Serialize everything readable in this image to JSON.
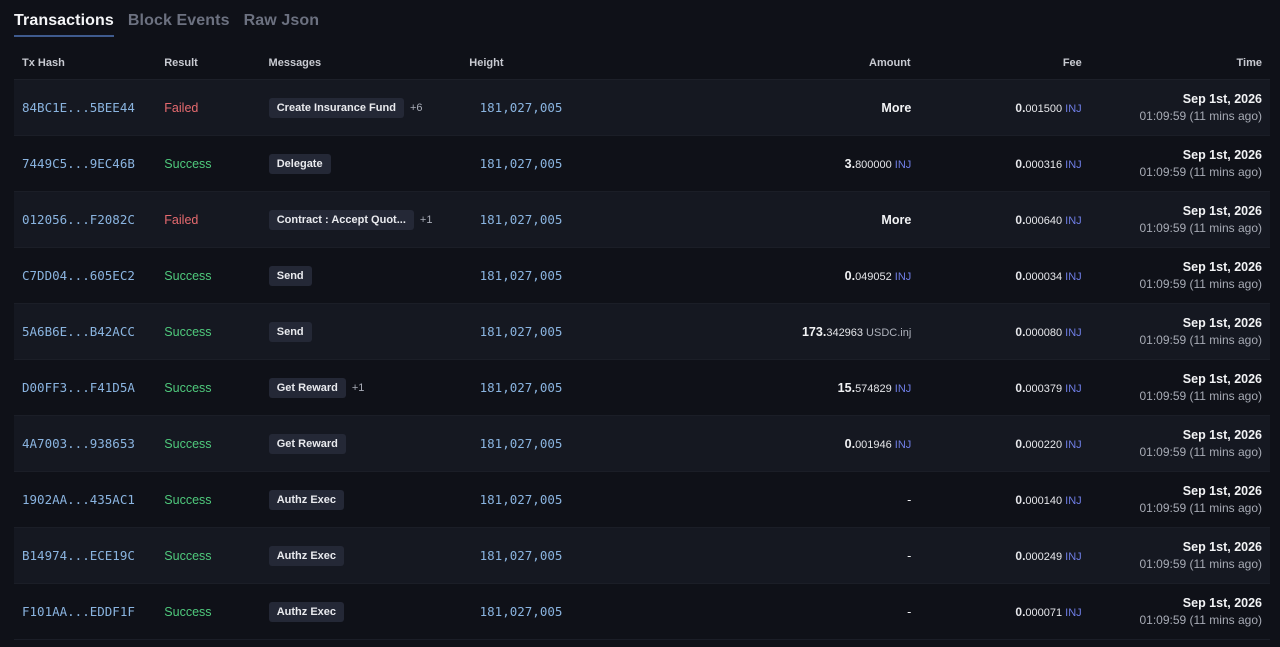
{
  "tabs": [
    {
      "label": "Transactions",
      "active": true
    },
    {
      "label": "Block Events",
      "active": false
    },
    {
      "label": "Raw Json",
      "active": false
    }
  ],
  "columns": {
    "hash": "Tx Hash",
    "result": "Result",
    "messages": "Messages",
    "height": "Height",
    "amount": "Amount",
    "fee": "Fee",
    "time": "Time"
  },
  "rows": [
    {
      "hash": "84BC1E...5BEE44",
      "result": "Failed",
      "status": "failed",
      "message": "Create Insurance Fund",
      "extra": "+6",
      "height": "181,027,005",
      "amount": {
        "int": "More",
        "frac": "",
        "unit": "",
        "type": "text"
      },
      "fee": {
        "int": "0.",
        "frac": "001500",
        "unit": "INJ"
      },
      "date": "Sep 1st, 2026",
      "time": "01:09:59 (11 mins ago)"
    },
    {
      "hash": "7449C5...9EC46B",
      "result": "Success",
      "status": "success",
      "message": "Delegate",
      "extra": "",
      "height": "181,027,005",
      "amount": {
        "int": "3.",
        "frac": "800000",
        "unit": "INJ",
        "type": "num"
      },
      "fee": {
        "int": "0.",
        "frac": "000316",
        "unit": "INJ"
      },
      "date": "Sep 1st, 2026",
      "time": "01:09:59 (11 mins ago)"
    },
    {
      "hash": "012056...F2082C",
      "result": "Failed",
      "status": "failed",
      "message": "Contract : Accept Quot...",
      "extra": "+1",
      "height": "181,027,005",
      "amount": {
        "int": "More",
        "frac": "",
        "unit": "",
        "type": "text"
      },
      "fee": {
        "int": "0.",
        "frac": "000640",
        "unit": "INJ"
      },
      "date": "Sep 1st, 2026",
      "time": "01:09:59 (11 mins ago)"
    },
    {
      "hash": "C7DD04...605EC2",
      "result": "Success",
      "status": "success",
      "message": "Send",
      "extra": "",
      "height": "181,027,005",
      "amount": {
        "int": "0.",
        "frac": "049052",
        "unit": "INJ",
        "type": "num"
      },
      "fee": {
        "int": "0.",
        "frac": "000034",
        "unit": "INJ"
      },
      "date": "Sep 1st, 2026",
      "time": "01:09:59 (11 mins ago)"
    },
    {
      "hash": "5A6B6E...B42ACC",
      "result": "Success",
      "status": "success",
      "message": "Send",
      "extra": "",
      "height": "181,027,005",
      "amount": {
        "int": "173.",
        "frac": "342963",
        "unit": "USDC.inj",
        "type": "num-grey"
      },
      "fee": {
        "int": "0.",
        "frac": "000080",
        "unit": "INJ"
      },
      "date": "Sep 1st, 2026",
      "time": "01:09:59 (11 mins ago)"
    },
    {
      "hash": "D00FF3...F41D5A",
      "result": "Success",
      "status": "success",
      "message": "Get Reward",
      "extra": "+1",
      "height": "181,027,005",
      "amount": {
        "int": "15.",
        "frac": "574829",
        "unit": "INJ",
        "type": "num"
      },
      "fee": {
        "int": "0.",
        "frac": "000379",
        "unit": "INJ"
      },
      "date": "Sep 1st, 2026",
      "time": "01:09:59 (11 mins ago)"
    },
    {
      "hash": "4A7003...938653",
      "result": "Success",
      "status": "success",
      "message": "Get Reward",
      "extra": "",
      "height": "181,027,005",
      "amount": {
        "int": "0.",
        "frac": "001946",
        "unit": "INJ",
        "type": "num"
      },
      "fee": {
        "int": "0.",
        "frac": "000220",
        "unit": "INJ"
      },
      "date": "Sep 1st, 2026",
      "time": "01:09:59 (11 mins ago)"
    },
    {
      "hash": "1902AA...435AC1",
      "result": "Success",
      "status": "success",
      "message": "Authz Exec",
      "extra": "",
      "height": "181,027,005",
      "amount": {
        "int": "-",
        "frac": "",
        "unit": "",
        "type": "dash"
      },
      "fee": {
        "int": "0.",
        "frac": "000140",
        "unit": "INJ"
      },
      "date": "Sep 1st, 2026",
      "time": "01:09:59 (11 mins ago)"
    },
    {
      "hash": "B14974...ECE19C",
      "result": "Success",
      "status": "success",
      "message": "Authz Exec",
      "extra": "",
      "height": "181,027,005",
      "amount": {
        "int": "-",
        "frac": "",
        "unit": "",
        "type": "dash"
      },
      "fee": {
        "int": "0.",
        "frac": "000249",
        "unit": "INJ"
      },
      "date": "Sep 1st, 2026",
      "time": "01:09:59 (11 mins ago)"
    },
    {
      "hash": "F101AA...EDDF1F",
      "result": "Success",
      "status": "success",
      "message": "Authz Exec",
      "extra": "",
      "height": "181,027,005",
      "amount": {
        "int": "-",
        "frac": "",
        "unit": "",
        "type": "dash"
      },
      "fee": {
        "int": "0.",
        "frac": "000071",
        "unit": "INJ"
      },
      "date": "Sep 1st, 2026",
      "time": "01:09:59 (11 mins ago)"
    }
  ],
  "colors": {
    "background": "#0f1118",
    "link": "#8ab4e0",
    "failed": "#e66a6f",
    "success": "#4fc97c",
    "inj": "#6f7ee6"
  }
}
